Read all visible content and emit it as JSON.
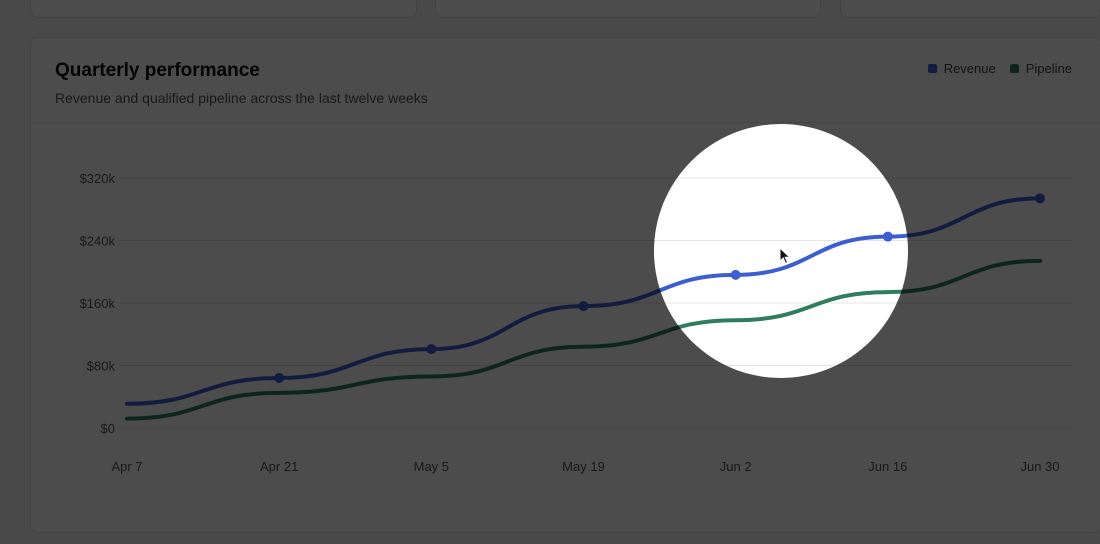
{
  "card": {
    "title": "Quarterly performance",
    "subtitle": "Revenue and qualified pipeline across the last twelve weeks"
  },
  "legend": [
    {
      "label": "Revenue",
      "color": "#3b5fd0"
    },
    {
      "label": "Pipeline",
      "color": "#2f7d5e"
    }
  ],
  "chart_data": {
    "type": "line",
    "title": "Quarterly performance",
    "subtitle": "Revenue and qualified pipeline across the last twelve weeks",
    "x_ticks": [
      "Apr 7",
      "Apr 21",
      "May 5",
      "May 19",
      "Jun 2",
      "Jun 16",
      "Jun 30"
    ],
    "y_ticks": [
      "$0",
      "$80k",
      "$160k",
      "$240k",
      "$320k"
    ],
    "ylim": [
      0,
      320000
    ],
    "grid": true,
    "legend_position": "top-right",
    "series": [
      {
        "name": "Revenue",
        "color": "#3b5fd0",
        "values": [
          31000,
          64000,
          101000,
          156000,
          196000,
          245000,
          294000
        ]
      },
      {
        "name": "Pipeline",
        "color": "#2f7d5e",
        "values": [
          12000,
          45000,
          66000,
          104000,
          138000,
          174000,
          214000
        ]
      }
    ]
  },
  "highlight": {
    "x_index": 4
  }
}
